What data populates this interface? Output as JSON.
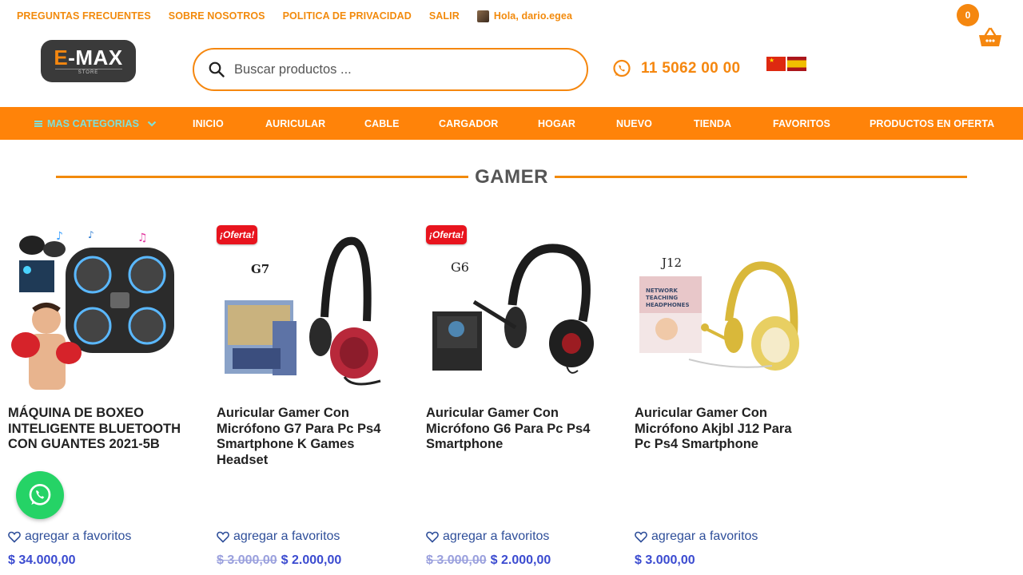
{
  "topbar": {
    "links": [
      "PREGUNTAS FRECUENTES",
      "SOBRE NOSOTROS",
      "POLITICA DE PRIVACIDAD",
      "SALIR"
    ],
    "greeting": "Hola, dario.egea"
  },
  "cart": {
    "count": "0"
  },
  "logo": {
    "text_accent": "E",
    "text_main": "-MAX",
    "sub": "STORE"
  },
  "search": {
    "placeholder": "Buscar productos ..."
  },
  "phone": {
    "number": "11 5062 00 00"
  },
  "nav": {
    "categories_label": "MAS CATEGORIAS",
    "items": [
      "INICIO",
      "AURICULAR",
      "CABLE",
      "CARGADOR",
      "HOGAR",
      "NUEVO",
      "TIENDA",
      "FAVORITOS",
      "PRODUCTOS EN OFERTA"
    ]
  },
  "section": {
    "title": "GAMER"
  },
  "products": [
    {
      "title": "MÁQUINA DE BOXEO INTELIGENTE BLUETOOTH CON GUANTES 2021-5B",
      "badge": "",
      "fav_label": "agregar a favoritos",
      "old_price": "",
      "price": "$ 34.000,00"
    },
    {
      "title": "Auricular Gamer Con Micrófono G7 Para Pc Ps4 Smartphone K Games Headset",
      "badge": "¡Oferta!",
      "img_label": "G7",
      "fav_label": "agregar a favoritos",
      "old_price": "$ 3.000,00",
      "price": "$ 2.000,00"
    },
    {
      "title": "Auricular Gamer Con Micrófono G6 Para Pc Ps4 Smartphone",
      "badge": "¡Oferta!",
      "img_label": "G6",
      "fav_label": "agregar a favoritos",
      "old_price": "$ 3.000,00",
      "price": "$ 2.000,00"
    },
    {
      "title": "Auricular Gamer Con Micrófono Akjbl J12 Para Pc Ps4 Smartphone",
      "badge": "",
      "img_label": "J12",
      "box_text": "NETWORK TEACHING HEADPHONES",
      "fav_label": "agregar a favoritos",
      "old_price": "",
      "price": "$ 3.000,00"
    }
  ],
  "colors": {
    "accent": "#f5870f",
    "nav_bg": "#ff8309",
    "price": "#3b4bd0",
    "badge": "#e8141e",
    "whatsapp": "#25d366"
  },
  "icons": {
    "search": "search-icon",
    "whatsapp": "whatsapp-icon",
    "cart": "basket-icon",
    "heart": "heart-icon"
  }
}
